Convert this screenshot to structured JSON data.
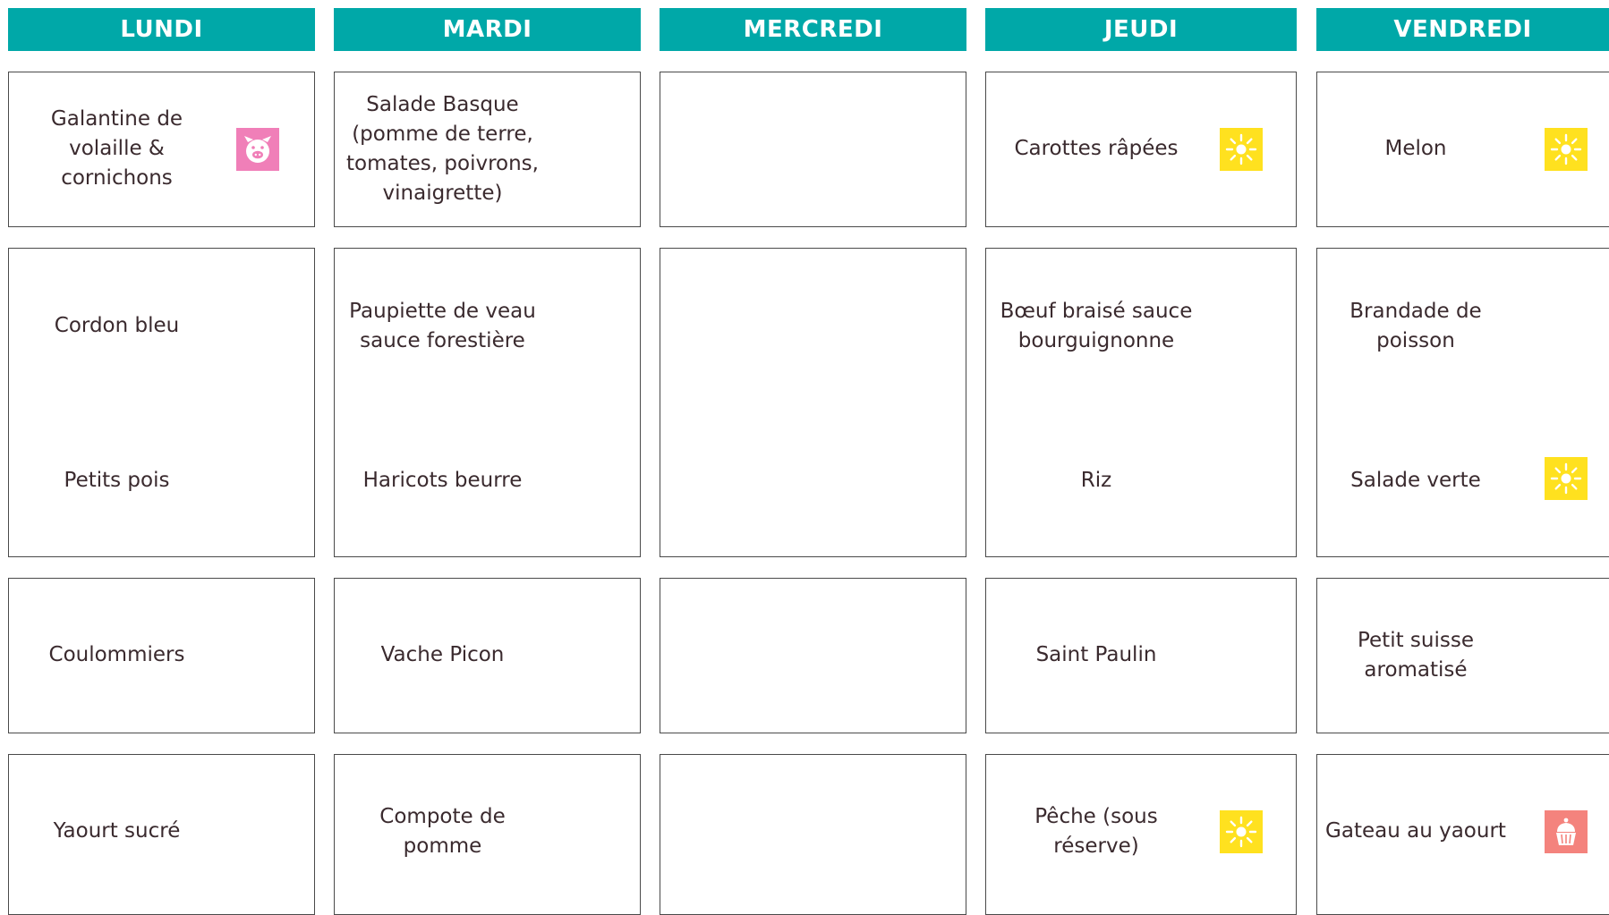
{
  "days": [
    "LUNDI",
    "MARDI",
    "MERCREDI",
    "JEUDI",
    "VENDREDI"
  ],
  "colors": {
    "header": "#00a8a8",
    "sun": "#ffe11f",
    "pork": "#f07fb8",
    "dessert": "#f4837d"
  },
  "menu": {
    "lundi": {
      "entree": "Galantine de\nvolaille &\ncornichons",
      "entree_icon": "pork-icon",
      "plat": "Cordon bleu",
      "accompagnement": "Petits pois",
      "fromage": "Coulommiers",
      "dessert": "Yaourt sucré"
    },
    "mardi": {
      "entree": "Salade Basque\n(pomme de terre,\ntomates, poivrons,\nvinaigrette)",
      "plat": "Paupiette de veau\nsauce forestière",
      "accompagnement": "Haricots beurre",
      "fromage": "Vache Picon",
      "dessert": "Compote de\npomme"
    },
    "mercredi": {},
    "jeudi": {
      "entree": "Carottes râpées",
      "entree_icon": "sun-icon",
      "plat": "Bœuf braisé sauce\nbourguignonne",
      "accompagnement": "Riz",
      "fromage": "Saint Paulin",
      "dessert": "Pêche (sous\nréserve)",
      "dessert_icon": "sun-icon"
    },
    "vendredi": {
      "entree": "Melon",
      "entree_icon": "sun-icon",
      "plat": "Brandade de\npoisson",
      "accompagnement": "Salade verte",
      "accompagnement_icon": "sun-icon",
      "fromage": "Petit suisse\naromatisé",
      "dessert": "Gateau au yaourt",
      "dessert_icon": "cupcake-icon"
    }
  }
}
